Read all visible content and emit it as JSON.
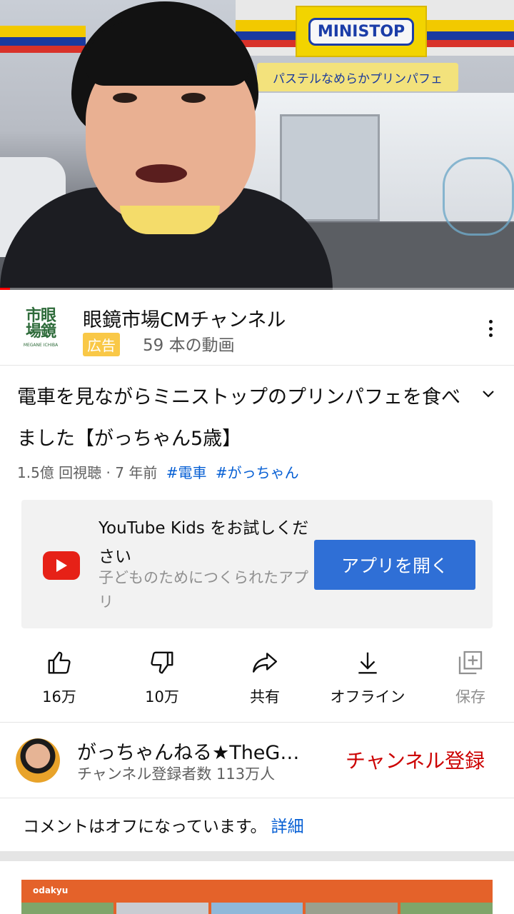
{
  "video": {
    "store_sign": "MINISTOP",
    "banner_text": "パステルなめらかプリンパフェ",
    "progress_fraction": 0.02
  },
  "ad": {
    "logo_text": "市眼場鏡",
    "logo_sub": "MEGANE ICHIBA",
    "channel_title": "眼鏡市場CMチャンネル",
    "badge": "広告",
    "video_count": "59 本の動画",
    "menu_icon": "more-vert-icon"
  },
  "video_info": {
    "title": "電車を見ながらミニストップのプリンパフェを食べました【がっちゃん5歳】",
    "views_time": "1.5億 回視聴 · 7 年前",
    "tags": [
      "#電車",
      "#がっちゃん"
    ]
  },
  "kids_promo": {
    "title": "YouTube Kids をお試しください",
    "subtitle": "子どものためにつくられたアプリ",
    "button": "アプリを開く"
  },
  "actions": [
    {
      "icon": "thumbs-up-icon",
      "label": "16万"
    },
    {
      "icon": "thumbs-down-icon",
      "label": "10万"
    },
    {
      "icon": "share-icon",
      "label": "共有"
    },
    {
      "icon": "download-icon",
      "label": "オフライン"
    },
    {
      "icon": "add-to-playlist-icon",
      "label": "保存"
    }
  ],
  "channel": {
    "name": "がっちゃんねる★TheG…",
    "subscribers": "チャンネル登録者数 113万人",
    "subscribe": "チャンネル登録"
  },
  "comments": {
    "text": "コメントはオフになっています。",
    "link": "詳細"
  },
  "next_card": {
    "brand": "odakyu"
  },
  "colors": {
    "accent_blue": "#065fd4",
    "subscribe_red": "#cc0000",
    "button_blue": "#2f6fd6",
    "ad_badge": "#f9c847"
  }
}
